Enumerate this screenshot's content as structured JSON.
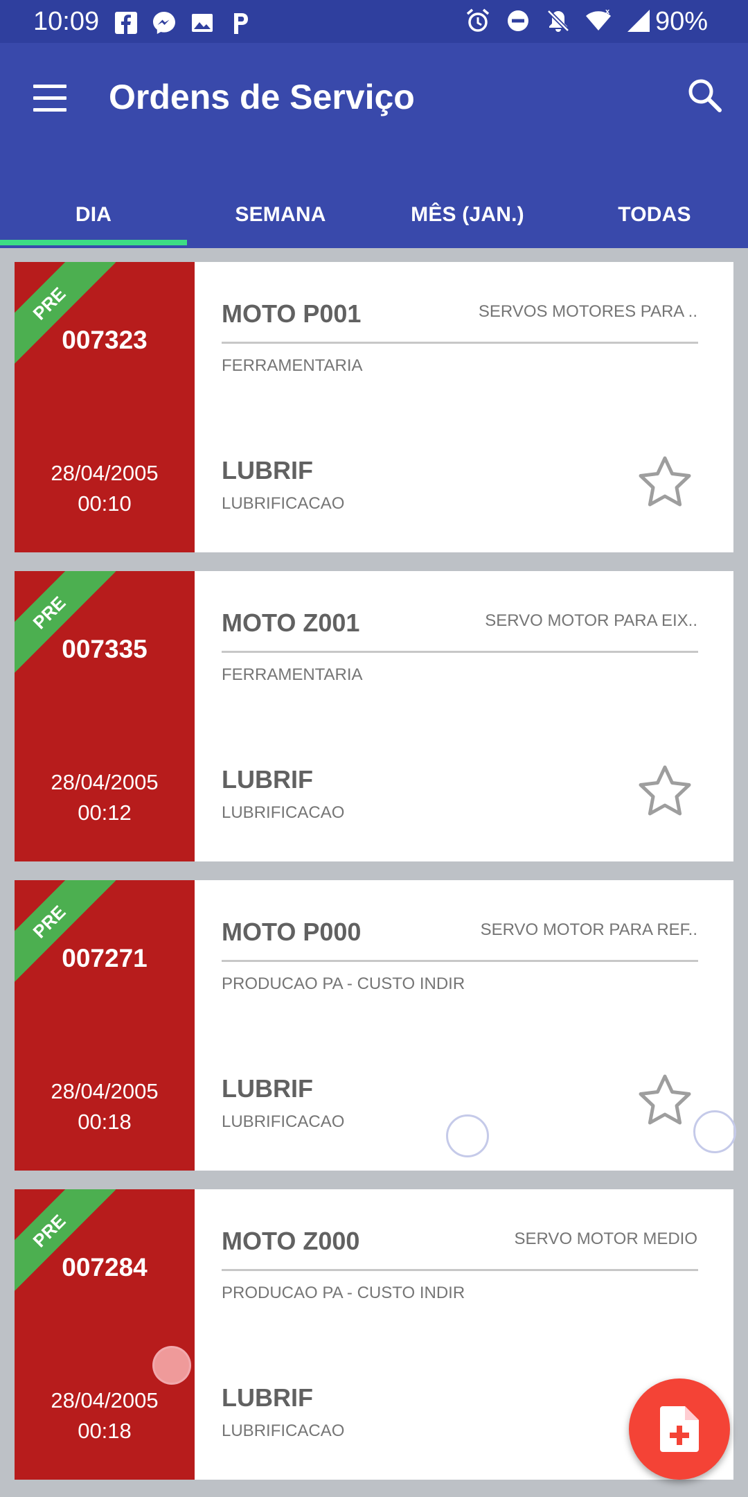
{
  "status_bar": {
    "time": "10:09",
    "left_icons": [
      "facebook-icon",
      "messenger-icon",
      "image-icon",
      "p-app-icon"
    ],
    "right_icons": [
      "alarm-icon",
      "do-not-disturb-icon",
      "notifications-off-icon",
      "wifi-icon",
      "signal-icon"
    ],
    "battery": "90%"
  },
  "app_bar": {
    "title": "Ordens de Serviço",
    "background": "#3949ab",
    "menu_icon": "hamburger-icon",
    "search_icon": "search-icon"
  },
  "tabs": [
    {
      "label": "DIA",
      "selected": true
    },
    {
      "label": "SEMANA",
      "selected": false
    },
    {
      "label": "MÊS (JAN.)",
      "selected": false
    },
    {
      "label": "TODAS",
      "selected": false
    }
  ],
  "accent_colors": {
    "tab_indicator": "#3ddc84",
    "card_status": "#b71c1c",
    "ribbon": "#4caf50",
    "fab": "#f44336"
  },
  "orders": [
    {
      "badge": "PRE",
      "number": "007323",
      "date": "28/04/2005",
      "time": "00:10",
      "equipment": "MOTO P001",
      "description": "SERVOS MOTORES PARA ..",
      "cost_center": "FERRAMENTARIA",
      "service": "LUBRIF",
      "service_description": "LUBRIFICACAO",
      "favorite": false
    },
    {
      "badge": "PRE",
      "number": "007335",
      "date": "28/04/2005",
      "time": "00:12",
      "equipment": "MOTO Z001",
      "description": "SERVO MOTOR PARA EIX..",
      "cost_center": "FERRAMENTARIA",
      "service": "LUBRIF",
      "service_description": "LUBRIFICACAO",
      "favorite": false
    },
    {
      "badge": "PRE",
      "number": "007271",
      "date": "28/04/2005",
      "time": "00:18",
      "equipment": "MOTO P000",
      "description": "SERVO MOTOR PARA REF..",
      "cost_center": "PRODUCAO PA - CUSTO INDIR",
      "service": "LUBRIF",
      "service_description": "LUBRIFICACAO",
      "favorite": false
    },
    {
      "badge": "PRE",
      "number": "007284",
      "date": "28/04/2005",
      "time": "00:18",
      "equipment": "MOTO Z000",
      "description": "SERVO MOTOR MEDIO",
      "cost_center": "PRODUCAO PA - CUSTO INDIR",
      "service": "LUBRIF",
      "service_description": "LUBRIFICACAO",
      "favorite": false
    }
  ],
  "fab": {
    "icon": "add-document-icon"
  }
}
